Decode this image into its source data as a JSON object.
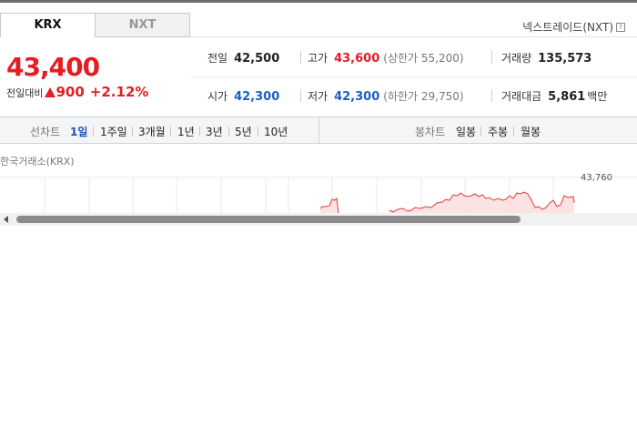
{
  "tabs": [
    {
      "label": "KRX",
      "active": true
    },
    {
      "label": "NXT",
      "active": false
    }
  ],
  "nxt_link": {
    "label": "넥스트레이드(NXT)",
    "help_glyph": "?"
  },
  "quote": {
    "price": "43,400",
    "change_label": "전일대비",
    "change_amount": "900",
    "change_rate": "+2.12%"
  },
  "stats": {
    "prev_close": {
      "label": "전일",
      "value": "42,500"
    },
    "high": {
      "label": "고가",
      "value": "43,600",
      "sub": "(상한가 55,200)"
    },
    "volume": {
      "label": "거래량",
      "value": "135,573"
    },
    "open": {
      "label": "시가",
      "value": "42,300"
    },
    "low": {
      "label": "저가",
      "value": "42,300",
      "sub": "(하한가 29,750)"
    },
    "amount": {
      "label": "거래대금",
      "value": "5,861",
      "unit": "백만"
    }
  },
  "line_chart_menu": {
    "label": "선차트",
    "items": [
      "1일",
      "1주일",
      "3개월",
      "1년",
      "3년",
      "5년",
      "10년"
    ],
    "active": "1일"
  },
  "candle_chart_menu": {
    "label": "봉차트",
    "items": [
      "일봉",
      "주봉",
      "월봉"
    ]
  },
  "chart": {
    "source": "한국거래소(KRX)",
    "top_value": "43,760"
  },
  "colors": {
    "up": "#e61d23",
    "down": "#1a5fc7",
    "active_menu": "#1a4fb5"
  }
}
